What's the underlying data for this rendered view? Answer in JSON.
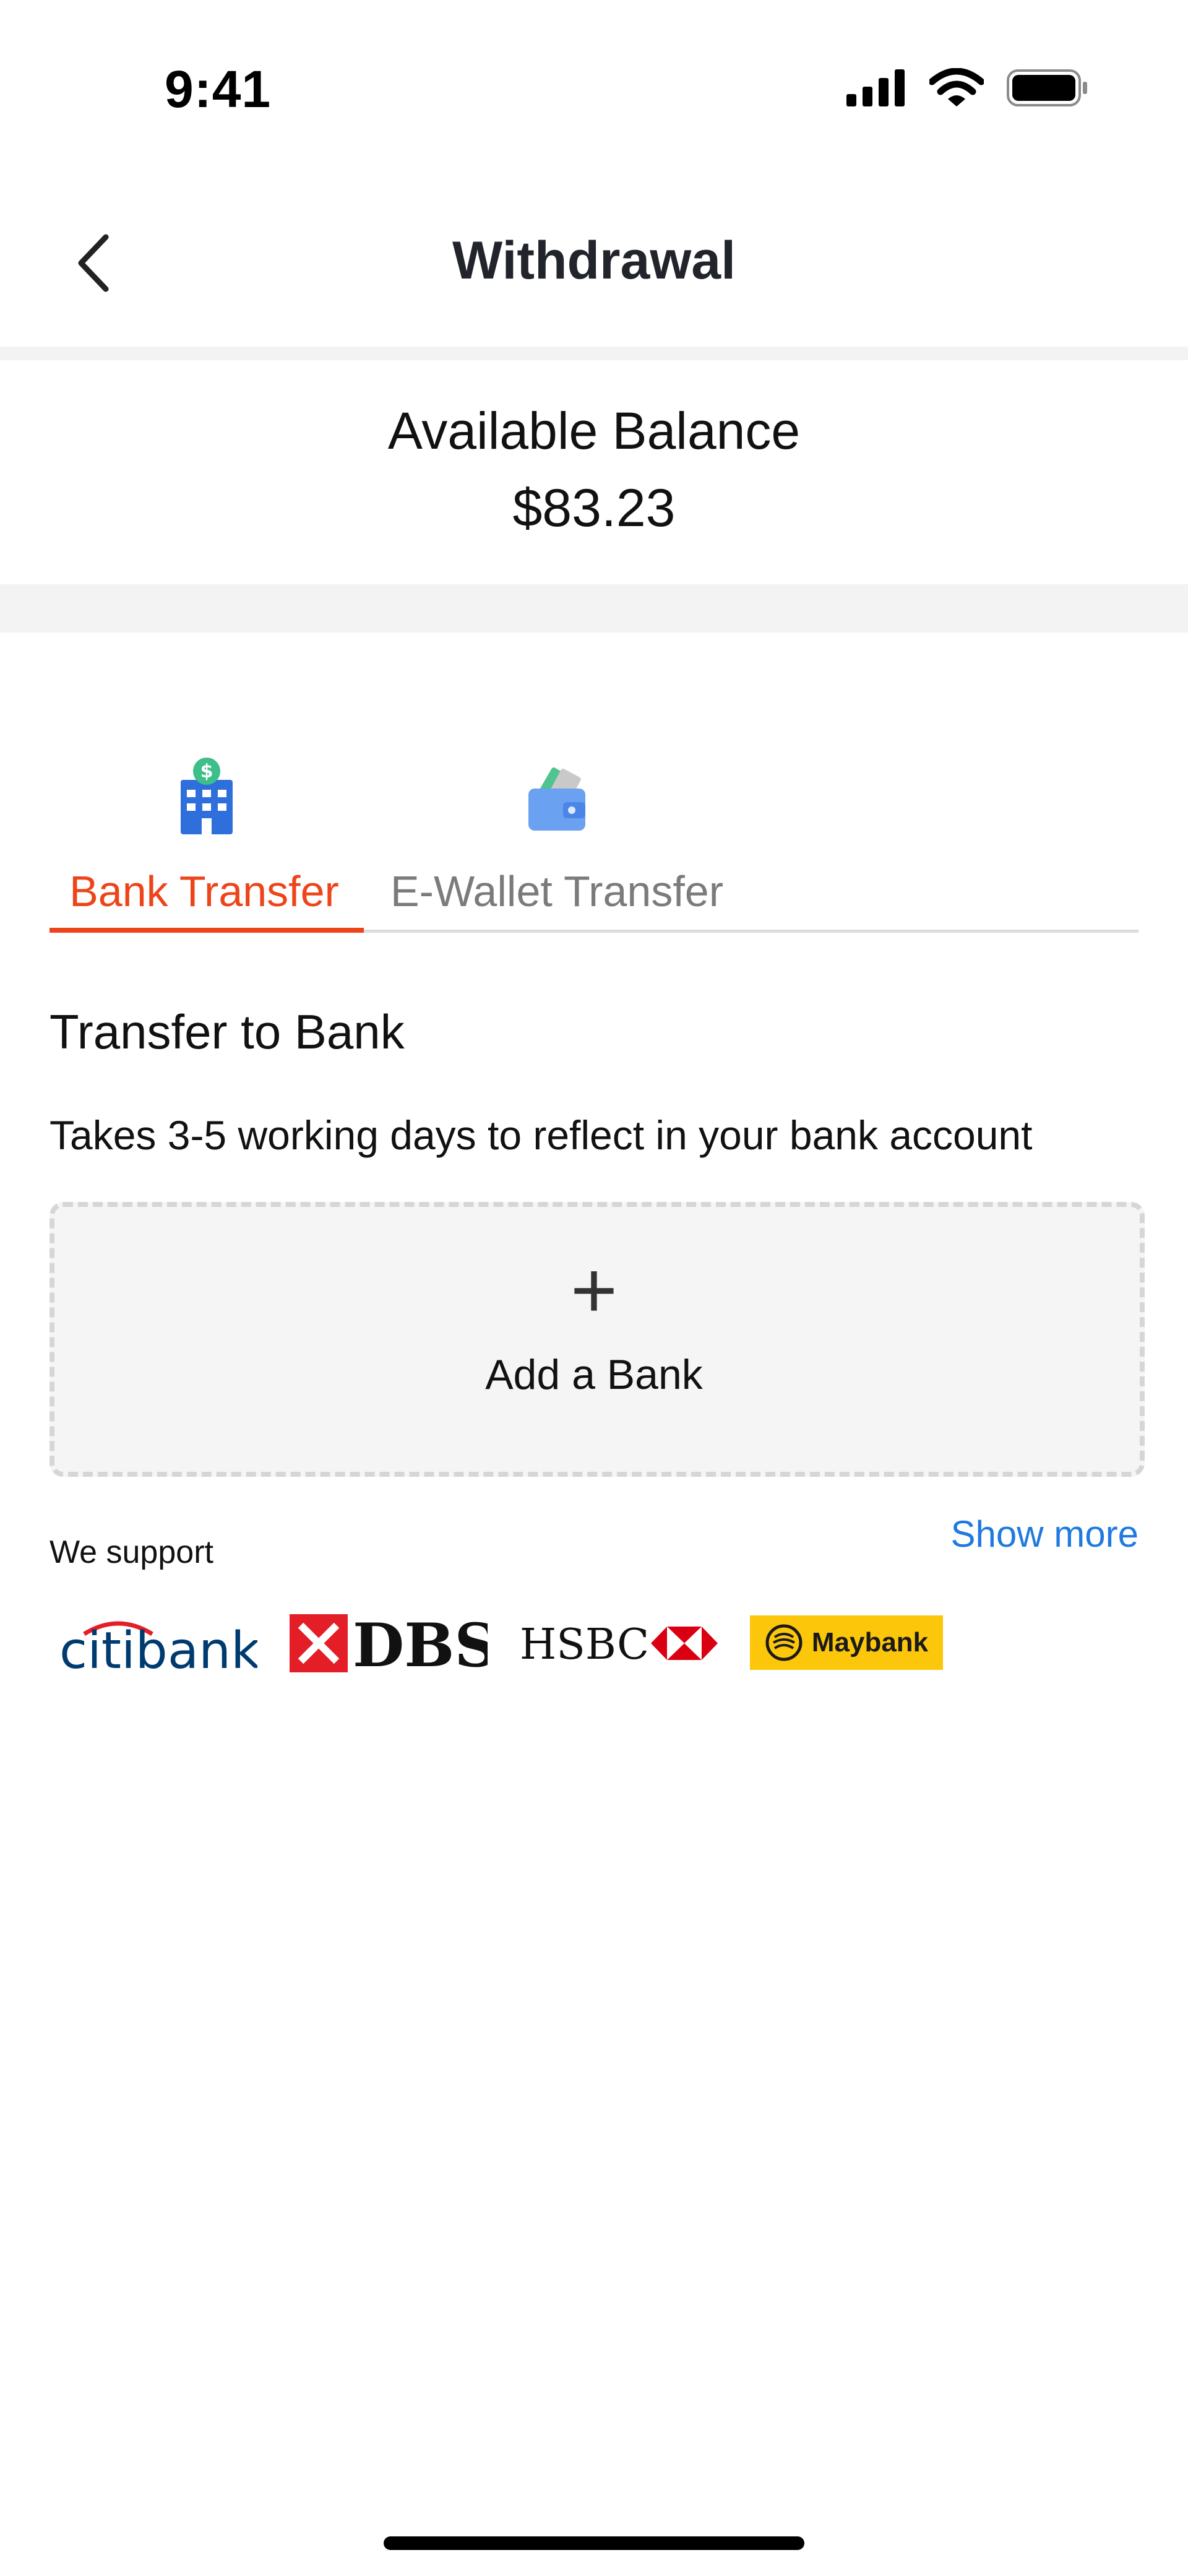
{
  "status_bar": {
    "time": "9:41",
    "icons": [
      "cellular-signal-icon",
      "wifi-icon",
      "battery-icon"
    ]
  },
  "nav": {
    "back_icon": "chevron-left-icon",
    "title": "Withdrawal"
  },
  "balance": {
    "label": "Available Balance",
    "value": "$83.23"
  },
  "tabs": [
    {
      "label": "Bank Transfer",
      "icon": "bank-building-icon",
      "active": true
    },
    {
      "label": "E-Wallet Transfer",
      "icon": "wallet-icon",
      "active": false
    }
  ],
  "section": {
    "title": "Transfer to Bank",
    "description": "Takes 3-5 working days to reflect in your bank account"
  },
  "add_bank": {
    "icon": "plus-icon",
    "label": "Add a Bank"
  },
  "support": {
    "label": "We support",
    "show_more": "Show more",
    "banks": [
      {
        "name": "citibank"
      },
      {
        "name": "DBS"
      },
      {
        "name": "HSBC"
      },
      {
        "name": "Maybank"
      }
    ]
  },
  "colors": {
    "accent": "#ee4419",
    "link": "#1f7ae0",
    "muted": "#7b7b7b",
    "separator": "#f3f3f3",
    "maybank_yellow": "#fcc60a",
    "dbs_red": "#e41e26",
    "hsbc_red": "#db0011",
    "citi_blue": "#003b70"
  }
}
